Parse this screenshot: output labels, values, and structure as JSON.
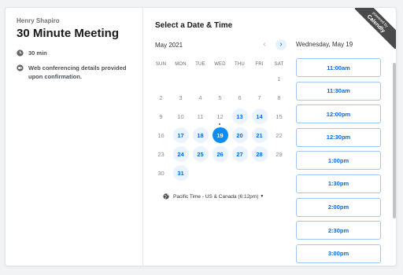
{
  "event": {
    "organizer": "Henry Shapiro",
    "title": "30 Minute Meeting",
    "duration": "30 min",
    "conferencing": "Web conferencing details provided upon confirmation."
  },
  "calendar": {
    "heading": "Select a Date & Time",
    "month": "May 2021",
    "weekdays": [
      "SUN",
      "MON",
      "TUE",
      "WED",
      "THU",
      "FRI",
      "SAT"
    ],
    "weeks": [
      [
        {
          "d": ""
        },
        {
          "d": ""
        },
        {
          "d": ""
        },
        {
          "d": ""
        },
        {
          "d": ""
        },
        {
          "d": ""
        },
        {
          "d": "1"
        }
      ],
      [
        {
          "d": "2"
        },
        {
          "d": "3"
        },
        {
          "d": "4"
        },
        {
          "d": "5"
        },
        {
          "d": "6"
        },
        {
          "d": "7"
        },
        {
          "d": "8"
        }
      ],
      [
        {
          "d": "9"
        },
        {
          "d": "10"
        },
        {
          "d": "11"
        },
        {
          "d": "12",
          "today": true
        },
        {
          "d": "13",
          "avail": true
        },
        {
          "d": "14",
          "avail": true
        },
        {
          "d": "15"
        }
      ],
      [
        {
          "d": "16"
        },
        {
          "d": "17",
          "avail": true
        },
        {
          "d": "18",
          "avail": true
        },
        {
          "d": "19",
          "sel": true
        },
        {
          "d": "20",
          "avail": true
        },
        {
          "d": "21",
          "avail": true
        },
        {
          "d": "22"
        }
      ],
      [
        {
          "d": "23"
        },
        {
          "d": "24",
          "avail": true
        },
        {
          "d": "25",
          "avail": true
        },
        {
          "d": "26",
          "avail": true
        },
        {
          "d": "27",
          "avail": true
        },
        {
          "d": "28",
          "avail": true
        },
        {
          "d": "29"
        }
      ],
      [
        {
          "d": "30"
        },
        {
          "d": "31",
          "avail": true
        },
        {
          "d": ""
        },
        {
          "d": ""
        },
        {
          "d": ""
        },
        {
          "d": ""
        },
        {
          "d": ""
        }
      ]
    ],
    "timezone": "Pacific Time - US & Canada (6:12pm)"
  },
  "times": {
    "date_label": "Wednesday, May 19",
    "slots": [
      "11:00am",
      "11:30am",
      "12:00pm",
      "12:30pm",
      "1:00pm",
      "1:30pm",
      "2:00pm",
      "2:30pm",
      "3:00pm"
    ]
  },
  "ribbon": {
    "small": "powered by",
    "brand": "Calendly"
  },
  "colors": {
    "accent": "#0a69e6",
    "selected": "#0a8cf0",
    "available_bg": "#ebf4fe",
    "slot_border": "#9fc7f5"
  }
}
